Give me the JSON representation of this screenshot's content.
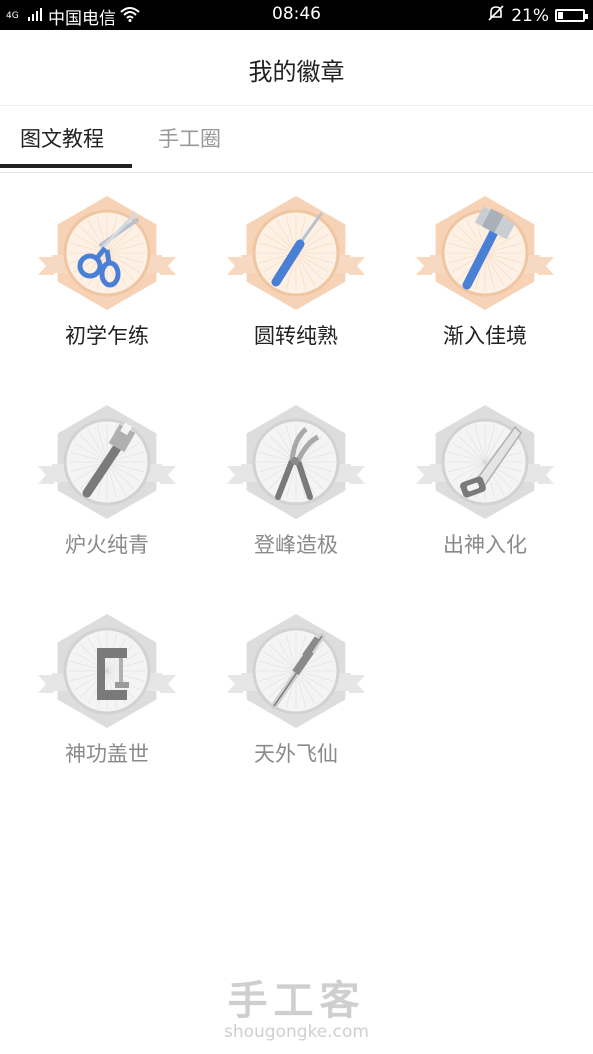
{
  "status_bar": {
    "signal": "4G",
    "carrier": "中国电信",
    "time": "08:46",
    "battery_percent": "21%",
    "battery_level": 0.21
  },
  "header": {
    "title": "我的徽章"
  },
  "tabs": [
    {
      "label": "图文教程",
      "active": true
    },
    {
      "label": "手工圈",
      "active": false
    }
  ],
  "badges": [
    {
      "label": "初学乍练",
      "earned": true,
      "icon": "scissors-icon"
    },
    {
      "label": "圆转纯熟",
      "earned": true,
      "icon": "screwdriver-icon"
    },
    {
      "label": "渐入佳境",
      "earned": true,
      "icon": "hammer-icon"
    },
    {
      "label": "炉火纯青",
      "earned": false,
      "icon": "wrench-icon"
    },
    {
      "label": "登峰造极",
      "earned": false,
      "icon": "pliers-icon"
    },
    {
      "label": "出神入化",
      "earned": false,
      "icon": "saw-icon"
    },
    {
      "label": "神功盖世",
      "earned": false,
      "icon": "clamp-icon"
    },
    {
      "label": "天外飞仙",
      "earned": false,
      "icon": "caliper-icon"
    }
  ],
  "watermark": {
    "logo": "手工客",
    "url": "shougongke.com"
  },
  "colors": {
    "earned_outer": "#f6d3b6",
    "earned_inner": "#fdf1e6",
    "earned_ribbon": "#f7d9c1",
    "locked_outer": "#dddddd",
    "locked_inner": "#f4f4f4",
    "locked_ribbon": "#e6e6e6",
    "tool_blue": "#4a7fd6",
    "tool_gray": "#7a7a7a"
  }
}
